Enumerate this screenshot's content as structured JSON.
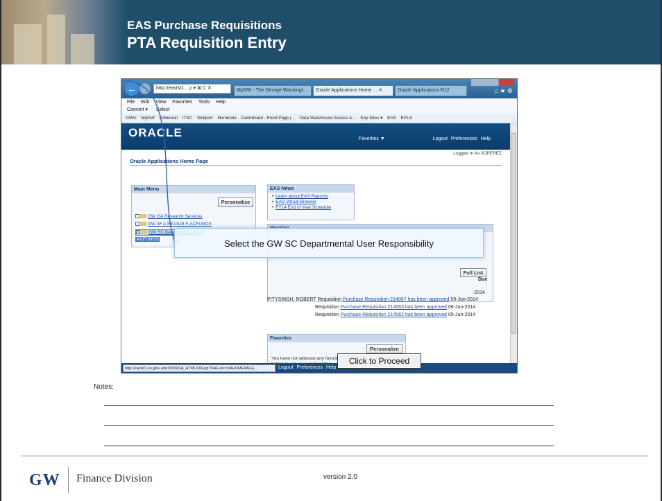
{
  "header": {
    "title": "EAS Purchase Requisitions",
    "subtitle": "PTA Requisition Entry"
  },
  "browser": {
    "address": "http://eastst1...  ρ ▾ ⊠ C ✕",
    "tabs": [
      "MyGW - The George Washingt...",
      "Oracle Applications Home ... ✕",
      "Oracle Applications R12"
    ],
    "menu": [
      "File",
      "Edit",
      "View",
      "Favorites",
      "Tools",
      "Help"
    ],
    "commands": [
      "Convert ▾",
      "Select"
    ],
    "favorites": [
      "GWU",
      "MyGW",
      "GWemail",
      "ITSC",
      "Skillport",
      "Illuminate",
      "Dashboard - Front Page |...",
      "Data Warehouse Access A...",
      "Key Sites ▾",
      "EAS",
      "EPLS"
    ],
    "status_url": "http://eastst1.es.gwu.edu:8003/OA_HTML/OA.jsp?OAFunc=OAHOMEPAGE..."
  },
  "oracle": {
    "logo": "ORACLE",
    "favorites_menu": "Favorites ▼",
    "header_links": "Logout  Preferences  Help",
    "logged_in": "Logged In As JOPEREZ",
    "page_title": "Oracle Applications Home Page",
    "footer_links": "Logout  Preferences  Help",
    "main_menu": {
      "title": "Main Menu",
      "personalize": "Personalize",
      "items": [
        "GW GA Research Services",
        "GW 3F A SEAS28 F-ACFUNDS",
        "GW SC Departmental User",
        "ACFUNDS"
      ]
    },
    "eas_news": {
      "title": "EAS News",
      "items": [
        "Learn about EAS Reports!",
        "EAS Virtual Browser",
        "FY14 End of Year Schedule"
      ]
    },
    "worklist": {
      "title": "Worklist",
      "full_list": "Full List",
      "due_header": "Due",
      "rows": [
        {
          "from": "PITYSINGH, ROBERT",
          "type": "Requisition",
          "subject": "Purchase Requisition 214067 has been approved",
          "date": "09-Jun-2014"
        },
        {
          "from": "",
          "type": "Requisition",
          "subject": "Purchase Requisition 214063 has been approved",
          "date": "06-Jun-2014"
        },
        {
          "from": "",
          "type": "Requisition",
          "subject": "Purchase Requisition 214062 has been approved",
          "date": "05-Jun-2014"
        }
      ],
      "partial_date": "-2014"
    },
    "favorites_box": {
      "title": "Favorites",
      "personalize": "Personalize",
      "text": "You have not selected any favorites. Please use the \"Personalize\" button to set up your favorites."
    }
  },
  "callout": "Select the GW SC Departmental User Responsibility",
  "proceed_button": "Click to Proceed",
  "notes_label": "Notes:",
  "footer": {
    "logo": "GW",
    "division": "Finance Division",
    "version": "version 2.0"
  }
}
